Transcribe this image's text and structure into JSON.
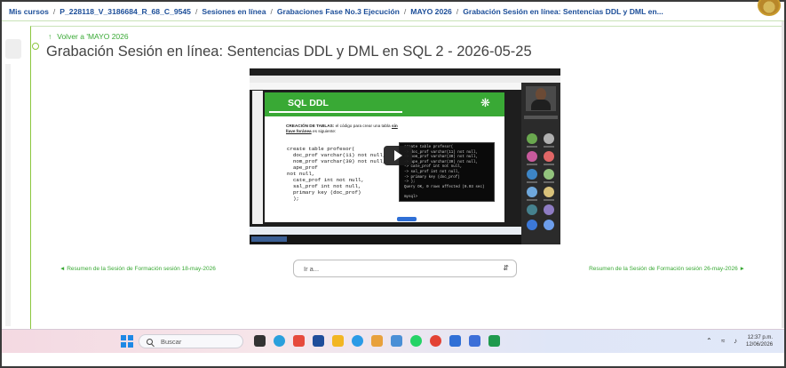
{
  "breadcrumb": {
    "items": [
      "Mis cursos",
      "P_228118_V_3186684_R_68_C_9545",
      "Sesiones en línea",
      "Grabaciones Fase No.3 Ejecución",
      "MAYO 2026",
      "Grabación Sesión en línea: Sentencias DDL y DML en..."
    ]
  },
  "page": {
    "back_link": "Volver a 'MAYO 2026",
    "title": "Grabación Sesión en línea: Sentencias DDL y DML en SQL 2 - 2026-05-25"
  },
  "video": {
    "slide_title": "SQL DDL",
    "slide_text_lead": "CREACIÓN DE TABLAS:",
    "slide_text_rest": " el código para crear una tabla ",
    "slide_text_bold": "sin llave foránea",
    "slide_text_end": " es siguiente:",
    "slide_code": "create table profesor(\n  doc_prof varchar(11) not null,\n  nom_prof varchar(30) not null,\n  ape_prof\nnot null,\n  cate_prof int not null,\n  sal_prof int not null,\n  primary key (doc_prof)\n  );",
    "terminal_text": "create table profesor(\n-> doc_prof varchar(11) not null,\n-> nom_prof varchar(30) not null,\n-> ape_prof varchar(30) not null,\n-> cate_prof int not null,\n-> sal_prof int not null,\n-> primary key (doc_prof)\n-> );\nQuery OK, 0 rows affected (0.03 sec)\n\nmysql>"
  },
  "navigation": {
    "prev_link": "◄ Resumen de la Sesión de Formación sesión 18-may-2026",
    "jump_placeholder": "Ir a...",
    "next_link": "Resumen de la Sesión de Formación sesión 26-may-2026 ►"
  },
  "taskbar": {
    "search_placeholder": "Buscar",
    "time": "12:37 p.m.",
    "date": "12/06/2026"
  },
  "colors": {
    "accent_green": "#39a935",
    "link_blue": "#1c4e99"
  }
}
